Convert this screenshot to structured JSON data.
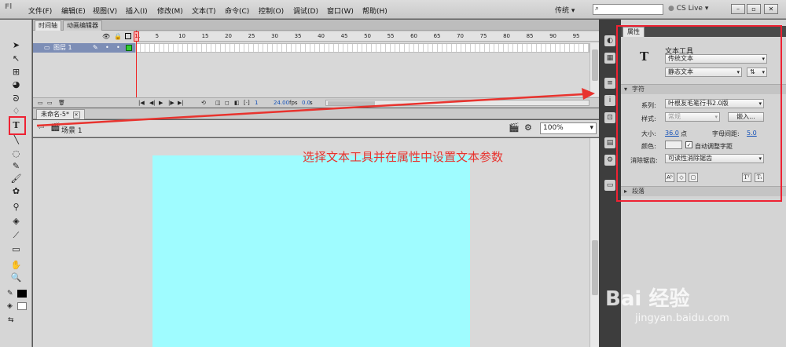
{
  "menubar": {
    "logo": "Fl",
    "items": [
      "文件(F)",
      "编辑(E)",
      "视图(V)",
      "插入(I)",
      "修改(M)",
      "文本(T)",
      "命令(C)",
      "控制(O)",
      "调试(D)",
      "窗口(W)",
      "帮助(H)"
    ],
    "workspace": "传统",
    "cs_live": "CS Live"
  },
  "timeline": {
    "tabs": [
      "时间轴",
      "动画编辑器"
    ],
    "frame_numbers": [
      "1",
      "5",
      "10",
      "15",
      "20",
      "25",
      "30",
      "35",
      "40",
      "45",
      "50",
      "55",
      "60",
      "65",
      "70",
      "75",
      "80",
      "85",
      "90",
      "95"
    ],
    "layer_name": "图层 1",
    "playhead_frame": "1",
    "fps": "24.00",
    "fps_unit": "fps",
    "time": "0.0",
    "time_unit": "s",
    "current_frame": "1"
  },
  "document": {
    "tab_title": "未命名-5*",
    "scene": "场景 1",
    "zoom": "100%",
    "stage_color": "#9ffcff"
  },
  "annotation": "选择文本工具并在属性中设置文本参数",
  "properties": {
    "tab": "属性",
    "tool_icon": "T",
    "tool_name": "文本工具",
    "text_engine": "传统文本",
    "text_type": "静态文本",
    "section_char": "字符",
    "family_label": "系列:",
    "family_value": "叶根友毛笔行书2.0版",
    "style_label": "样式:",
    "style_value": "常规",
    "embed_button": "嵌入...",
    "size_label": "大小:",
    "size_value": "36.0",
    "size_unit": "点",
    "spacing_label": "字母间距:",
    "spacing_value": "5.0",
    "color_label": "颜色:",
    "autokern_label": "自动调整字距",
    "antialias_label": "消除锯齿:",
    "antialias_value": "可读性消除锯齿",
    "section_para": "段落"
  },
  "watermark": {
    "brand": "Bai 经验",
    "url": "jingyan.baidu.com"
  },
  "colors": {
    "annotation_red": "#e8332e",
    "layer_selected": "#7d8eb6",
    "link_blue": "#1552b8"
  }
}
